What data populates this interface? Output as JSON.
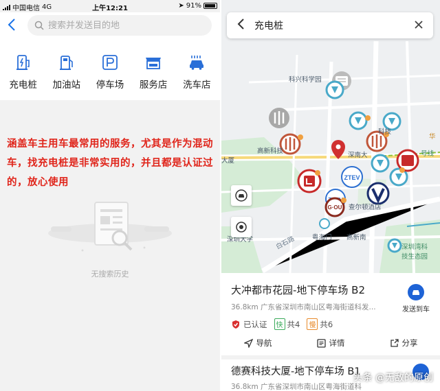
{
  "left": {
    "status": {
      "carrier": "中国电信",
      "network": "4G",
      "time": "上午12:21",
      "battery": "91%"
    },
    "search": {
      "placeholder": "搜索并发送目的地"
    },
    "categories": [
      {
        "label": "充电桩",
        "icon": "charging-pile-icon"
      },
      {
        "label": "加油站",
        "icon": "gas-station-icon"
      },
      {
        "label": "停车场",
        "icon": "parking-icon"
      },
      {
        "label": "服务店",
        "icon": "service-shop-icon"
      },
      {
        "label": "洗车店",
        "icon": "car-wash-icon"
      }
    ],
    "overlay_text": "涵盖车主用车最常用的服务，尤其是作为混动车，找充电桩是非常实用的，并且都是认证过的，放心使用",
    "empty_text": "无搜索历史"
  },
  "right": {
    "search_title": "充电桩",
    "map_labels": {
      "l1": "科兴科学园",
      "l2": "高新科技",
      "l3": "深南大",
      "l4": "科技",
      "l5": "华",
      "l6": "大厦",
      "l7": "查尔顿酒店",
      "l8": "深圳大学",
      "l9": "白石路",
      "l10": "粤海门",
      "l11": "高新南",
      "l12": "深圳湾科",
      "l13": "技生态园",
      "l14": "号线"
    },
    "brand_labels": {
      "ztev1": "ZTEV",
      "ztev2": "ZTEV",
      "gou": "G·OU"
    },
    "poi": {
      "title": "大冲都市花园-地下停车场 B2",
      "address": "36.8km 广东省深圳市南山区粤海街道科发...",
      "certified": "已认证",
      "fast_tag": "快",
      "fast_count": "共4",
      "slow_tag": "慢",
      "slow_count": "共6",
      "send_label": "发送到车",
      "actions": {
        "navigate": "导航",
        "details": "详情",
        "share": "分享"
      }
    },
    "poi2": {
      "title": "德赛科技大厦-地下停车场 B1",
      "address": "36.8km 广东省深圳市南山区粤海街道科"
    },
    "watermark": "头条 @无敌的原创"
  },
  "colors": {
    "accent": "#1a73e8",
    "overlay_red": "#e0251b",
    "send_blue": "#1e63d6"
  }
}
